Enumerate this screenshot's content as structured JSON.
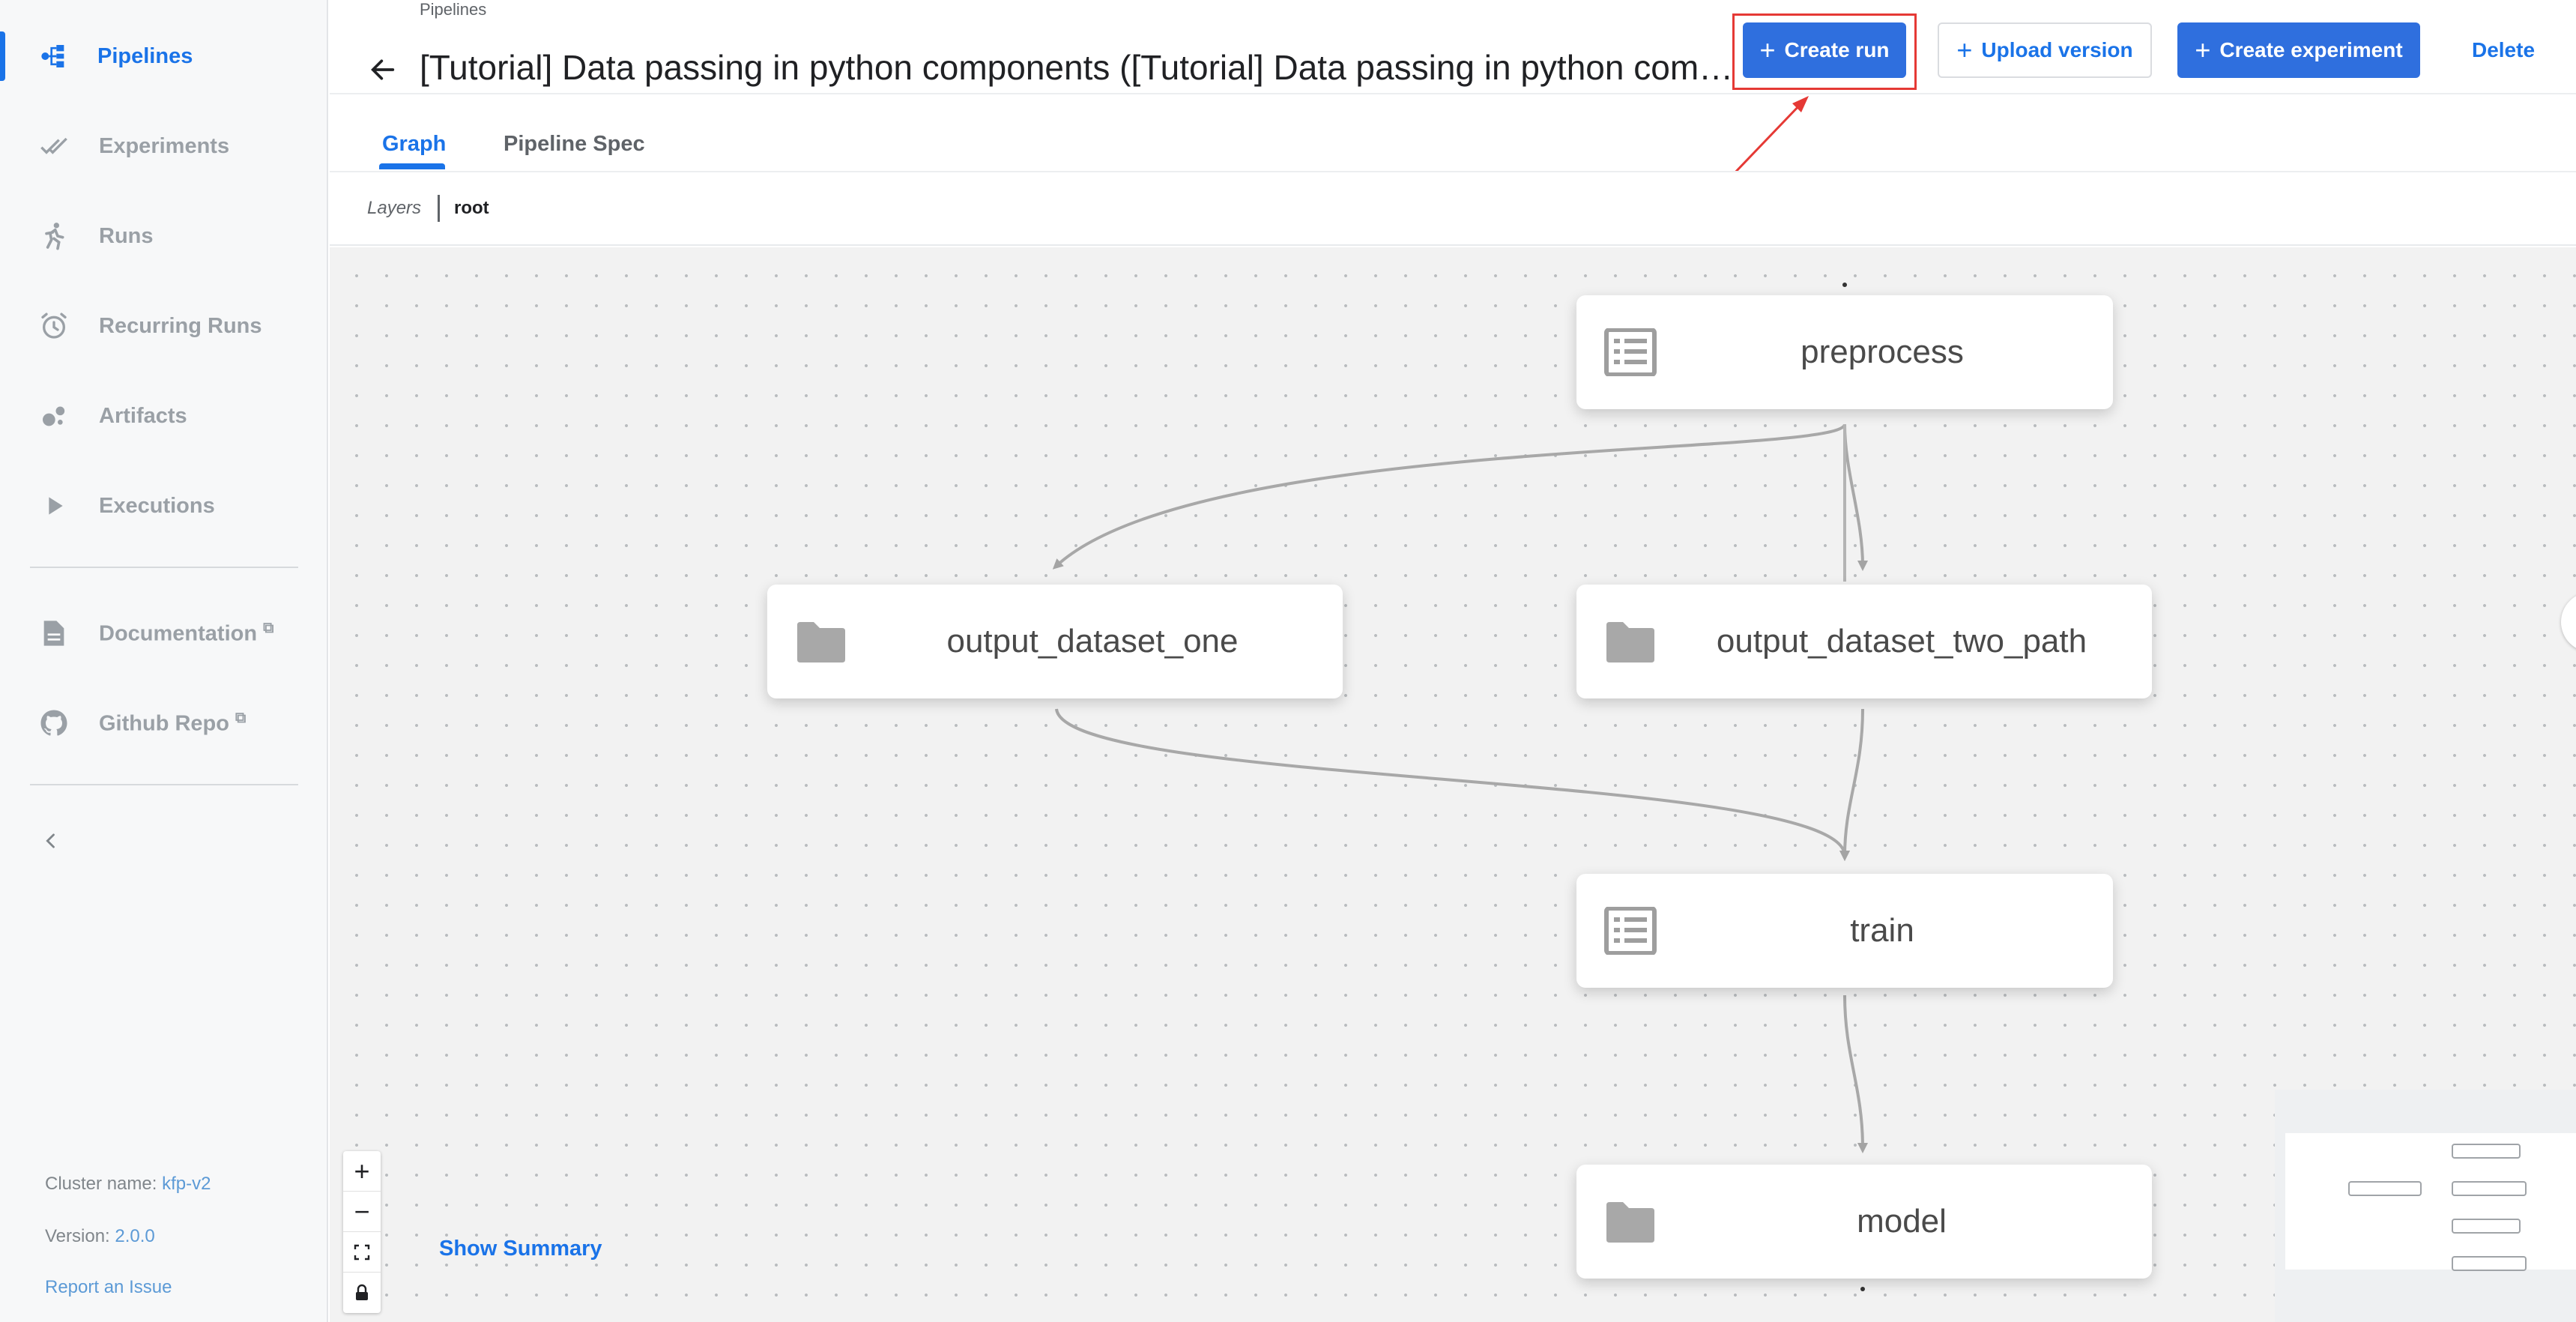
{
  "sidebar": {
    "items": [
      {
        "label": "Pipelines",
        "icon": "pipelines-icon",
        "active": true
      },
      {
        "label": "Experiments",
        "icon": "experiments-icon",
        "active": false
      },
      {
        "label": "Runs",
        "icon": "runs-icon",
        "active": false
      },
      {
        "label": "Recurring Runs",
        "icon": "alarm-clock-icon",
        "active": false
      },
      {
        "label": "Artifacts",
        "icon": "artifacts-icon",
        "active": false
      },
      {
        "label": "Executions",
        "icon": "play-icon",
        "active": false
      }
    ],
    "links": [
      {
        "label": "Documentation",
        "icon": "document-icon",
        "external_icon": "external-link-icon"
      },
      {
        "label": "Github Repo",
        "icon": "github-icon",
        "external_icon": "external-link-icon"
      }
    ],
    "cluster_label": "Cluster name:",
    "cluster_value": "kfp-v2",
    "version_label": "Version:",
    "version_value": "2.0.0",
    "report_issue": "Report an Issue"
  },
  "header": {
    "breadcrumb": "Pipelines",
    "title": "[Tutorial] Data passing in python components ([Tutorial] Data passing in python components)",
    "buttons": {
      "create_run": "Create run",
      "upload_version": "Upload version",
      "create_experiment": "Create experiment",
      "delete": "Delete"
    }
  },
  "tabs": [
    {
      "label": "Graph",
      "active": true
    },
    {
      "label": "Pipeline Spec",
      "active": false
    }
  ],
  "layers": {
    "label": "Layers",
    "root": "root"
  },
  "graph": {
    "nodes": [
      {
        "id": "preprocess",
        "label": "preprocess",
        "icon": "list-icon"
      },
      {
        "id": "output_dataset_one",
        "label": "output_dataset_one",
        "icon": "folder-icon"
      },
      {
        "id": "output_dataset_two_path",
        "label": "output_dataset_two_path",
        "icon": "folder-icon"
      },
      {
        "id": "train",
        "label": "train",
        "icon": "list-icon"
      },
      {
        "id": "model",
        "label": "model",
        "icon": "folder-icon"
      }
    ],
    "edges": [
      [
        "preprocess",
        "output_dataset_one"
      ],
      [
        "preprocess",
        "output_dataset_two_path"
      ],
      [
        "output_dataset_one",
        "train"
      ],
      [
        "output_dataset_two_path",
        "train"
      ],
      [
        "train",
        "model"
      ]
    ]
  },
  "controls": {
    "zoom_in": "+",
    "zoom_out": "−",
    "show_summary": "Show Summary"
  },
  "colors": {
    "accent": "#1a73e8",
    "primary_button": "#2f6fde",
    "highlight": "#e53935"
  }
}
